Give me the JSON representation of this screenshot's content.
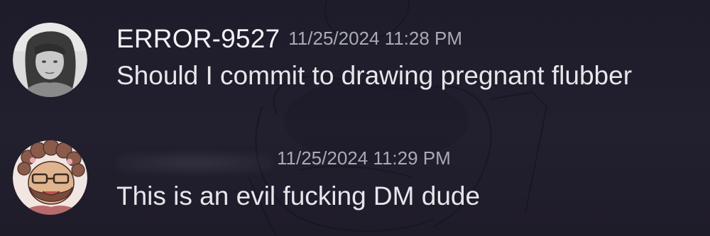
{
  "messages": [
    {
      "username": "ERROR-9527",
      "timestamp": "11/25/2024 11:28 PM",
      "text": "Should I commit to drawing pregnant flubber",
      "avatar": "photo-avatar-icon"
    },
    {
      "username": "",
      "timestamp": "11/25/2024 11:29 PM",
      "text": "This is an evil fucking DM dude",
      "avatar": "drawn-character-avatar-icon"
    }
  ],
  "colors": {
    "background": "#1f1d2b",
    "username": "#f2f3f5",
    "timestamp": "#a9abb3",
    "message_text": "#e6e7ea"
  }
}
